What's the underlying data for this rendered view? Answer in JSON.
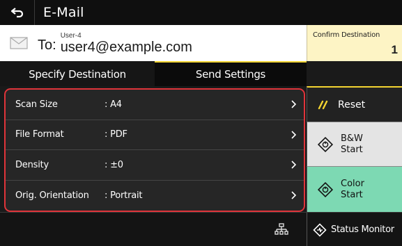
{
  "header": {
    "title": "E-Mail"
  },
  "destination": {
    "to_label": "To:",
    "name": "User-4",
    "address": "user4@example.com"
  },
  "confirm": {
    "label": "Confirm Destination",
    "count": "1"
  },
  "tabs": [
    {
      "label": "Specify Destination",
      "active": false
    },
    {
      "label": "Send Settings",
      "active": true
    }
  ],
  "settings": [
    {
      "label": "Scan Size",
      "value": ": A4"
    },
    {
      "label": "File Format",
      "value": ": PDF"
    },
    {
      "label": "Density",
      "value": ": ±0"
    },
    {
      "label": "Orig. Orientation",
      "value": ": Portrait"
    }
  ],
  "side": {
    "reset": "Reset",
    "bw_line1": "B&W",
    "bw_line2": "Start",
    "color_line1": "Color",
    "color_line2": "Start"
  },
  "footer": {
    "status_monitor": "Status Monitor"
  },
  "icons": {
    "back": "back-arrow-icon",
    "mail": "envelope-icon",
    "reset": "reset-slash-icon",
    "start": "start-diamond-icon",
    "network": "network-icon",
    "status": "status-monitor-icon"
  },
  "colors": {
    "highlight_border": "#e0343a",
    "tab_accent": "#f3d431",
    "confirm_bg": "#fdf4c5",
    "color_start_bg": "#7dd9b3",
    "bw_start_bg": "#e4e4e4"
  }
}
